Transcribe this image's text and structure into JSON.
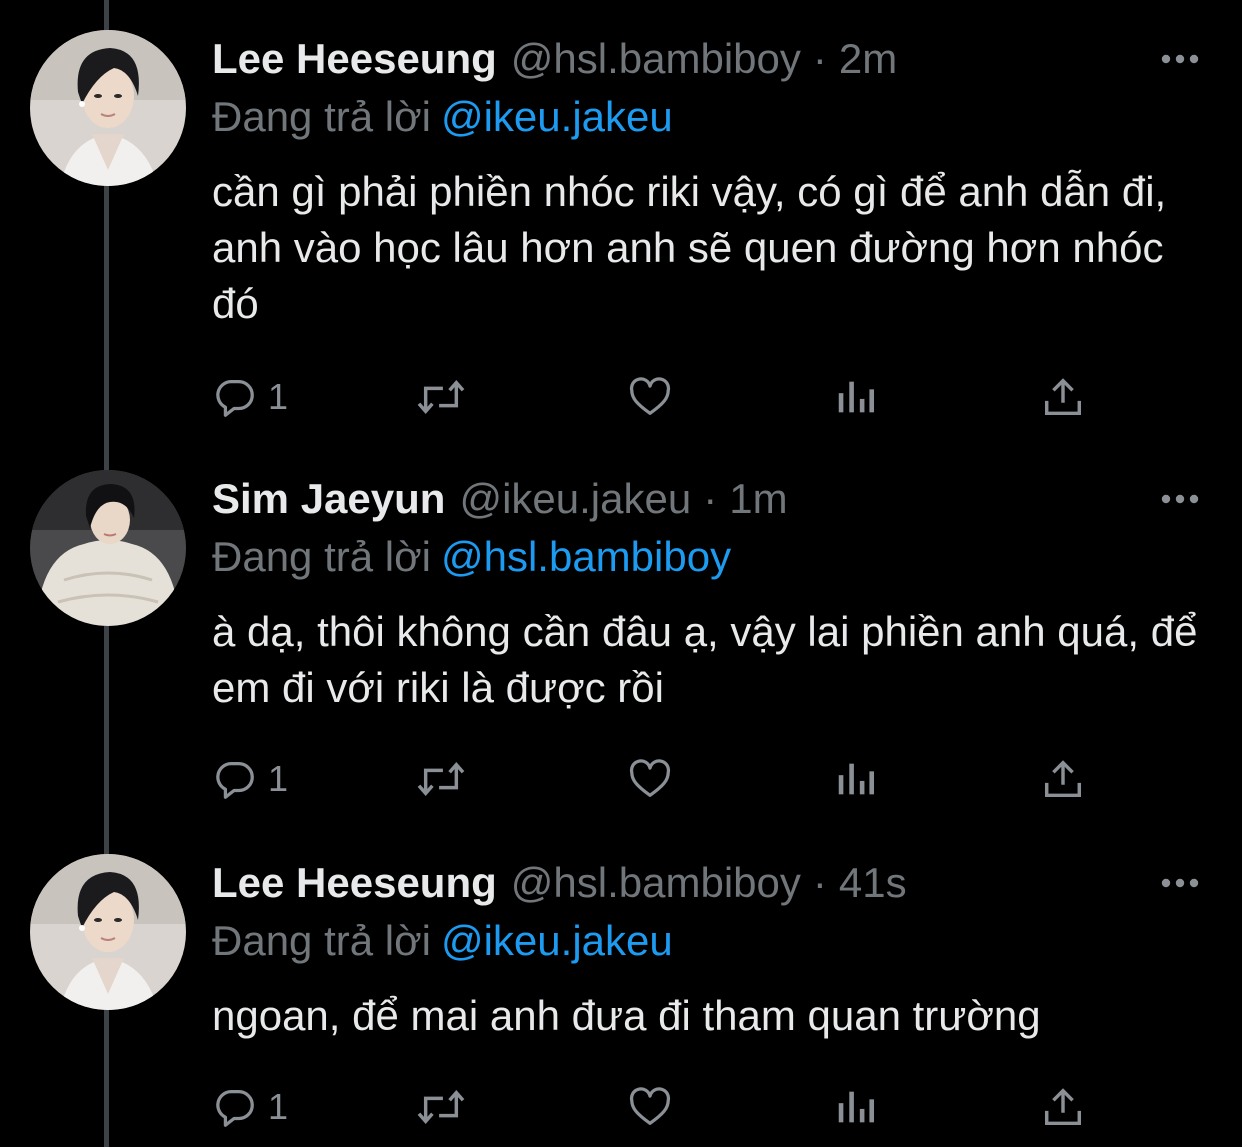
{
  "colors": {
    "background": "#000000",
    "text": "#e7e9ea",
    "secondary": "#71767b",
    "link": "#1d9bf0",
    "thread_line": "#3d4247"
  },
  "icons": {
    "reply": "reply-icon",
    "retweet": "retweet-icon",
    "like": "heart-icon",
    "analytics": "analytics-icon",
    "share": "share-icon",
    "more": "more-icon"
  },
  "tweets": [
    {
      "display_name": "Lee Heeseung",
      "handle": "@hsl.bambiboy",
      "separator": "·",
      "time": "2m",
      "replying_label": "Đang trả lời",
      "replying_to": "@ikeu.jakeu",
      "text": "cần gì phải phiền nhóc riki vậy, có gì để anh dẫn đi, anh vào học lâu hơn anh sẽ quen đường hơn nhóc đó",
      "reply_count": "1"
    },
    {
      "display_name": "Sim Jaeyun",
      "handle": "@ikeu.jakeu",
      "separator": "·",
      "time": "1m",
      "replying_label": "Đang trả lời",
      "replying_to": "@hsl.bambiboy",
      "text": "à dạ, thôi không cần đâu ạ, vậy lai phiền anh quá, để em đi với riki là được rồi",
      "reply_count": "1"
    },
    {
      "display_name": "Lee Heeseung",
      "handle": "@hsl.bambiboy",
      "separator": "·",
      "time": "41s",
      "replying_label": "Đang trả lời",
      "replying_to": "@ikeu.jakeu",
      "text": "ngoan, để mai anh đưa đi tham quan trường",
      "reply_count": "1"
    }
  ]
}
